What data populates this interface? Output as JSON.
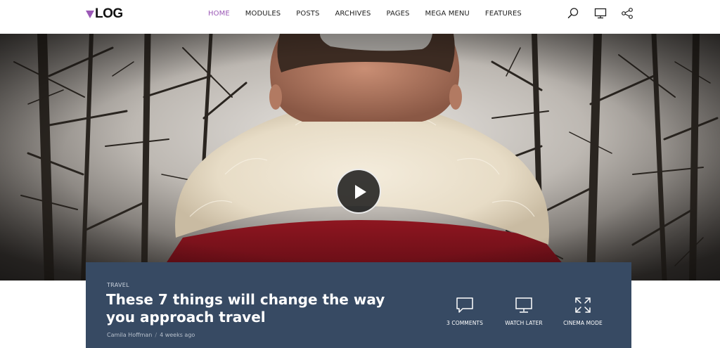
{
  "brand": {
    "name": "LOG",
    "accent": "#9b59b6"
  },
  "nav": {
    "items": [
      {
        "label": "HOME",
        "active": true
      },
      {
        "label": "MODULES",
        "active": false
      },
      {
        "label": "POSTS",
        "active": false
      },
      {
        "label": "ARCHIVES",
        "active": false
      },
      {
        "label": "PAGES",
        "active": false
      },
      {
        "label": "MEGA MENU",
        "active": false
      },
      {
        "label": "FEATURES",
        "active": false
      }
    ],
    "icons": [
      "search-icon",
      "monitor-icon",
      "share-icon"
    ]
  },
  "hero": {
    "play_icon": "play-icon"
  },
  "post": {
    "category": "TRAVEL",
    "title": "These 7 things will change the way you approach travel",
    "author": "Camila Hoffman",
    "separator": "/",
    "date": "4 weeks ago",
    "panel_color": "#374a63"
  },
  "actions": [
    {
      "label": "3 COMMENTS",
      "icon": "comment-icon"
    },
    {
      "label": "WATCH LATER",
      "icon": "monitor-icon"
    },
    {
      "label": "CINEMA MODE",
      "icon": "expand-icon"
    }
  ]
}
